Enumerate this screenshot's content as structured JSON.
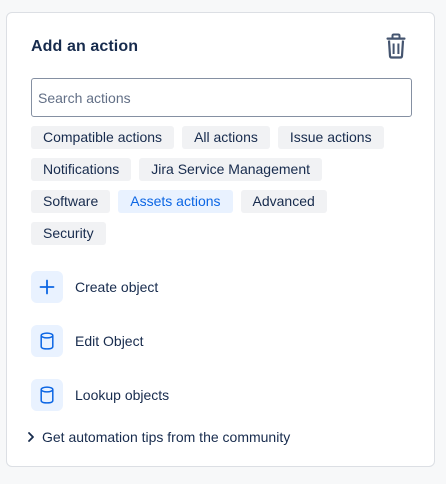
{
  "panel": {
    "title": "Add an action",
    "delete_icon": "trash-icon"
  },
  "search": {
    "placeholder": "Search actions",
    "value": ""
  },
  "filters": {
    "rows": [
      [
        "Compatible actions",
        "All actions",
        "Issue actions"
      ],
      [
        "Notifications",
        "Jira Service Management"
      ],
      [
        "Software",
        "Assets actions",
        "Advanced"
      ],
      [
        "Security"
      ]
    ],
    "selected": "Assets actions"
  },
  "actions": [
    {
      "label": "Create object",
      "icon": "plus-icon"
    },
    {
      "label": "Edit Object",
      "icon": "database-icon"
    },
    {
      "label": "Lookup objects",
      "icon": "database-icon"
    }
  ],
  "tips": {
    "label": "Get automation tips from the community",
    "icon": "chevron-right-icon"
  },
  "colors": {
    "accent": "#0c66e4",
    "accent_bg": "#e9f2ff",
    "chip_bg": "#f1f2f4",
    "text": "#172b4d"
  }
}
